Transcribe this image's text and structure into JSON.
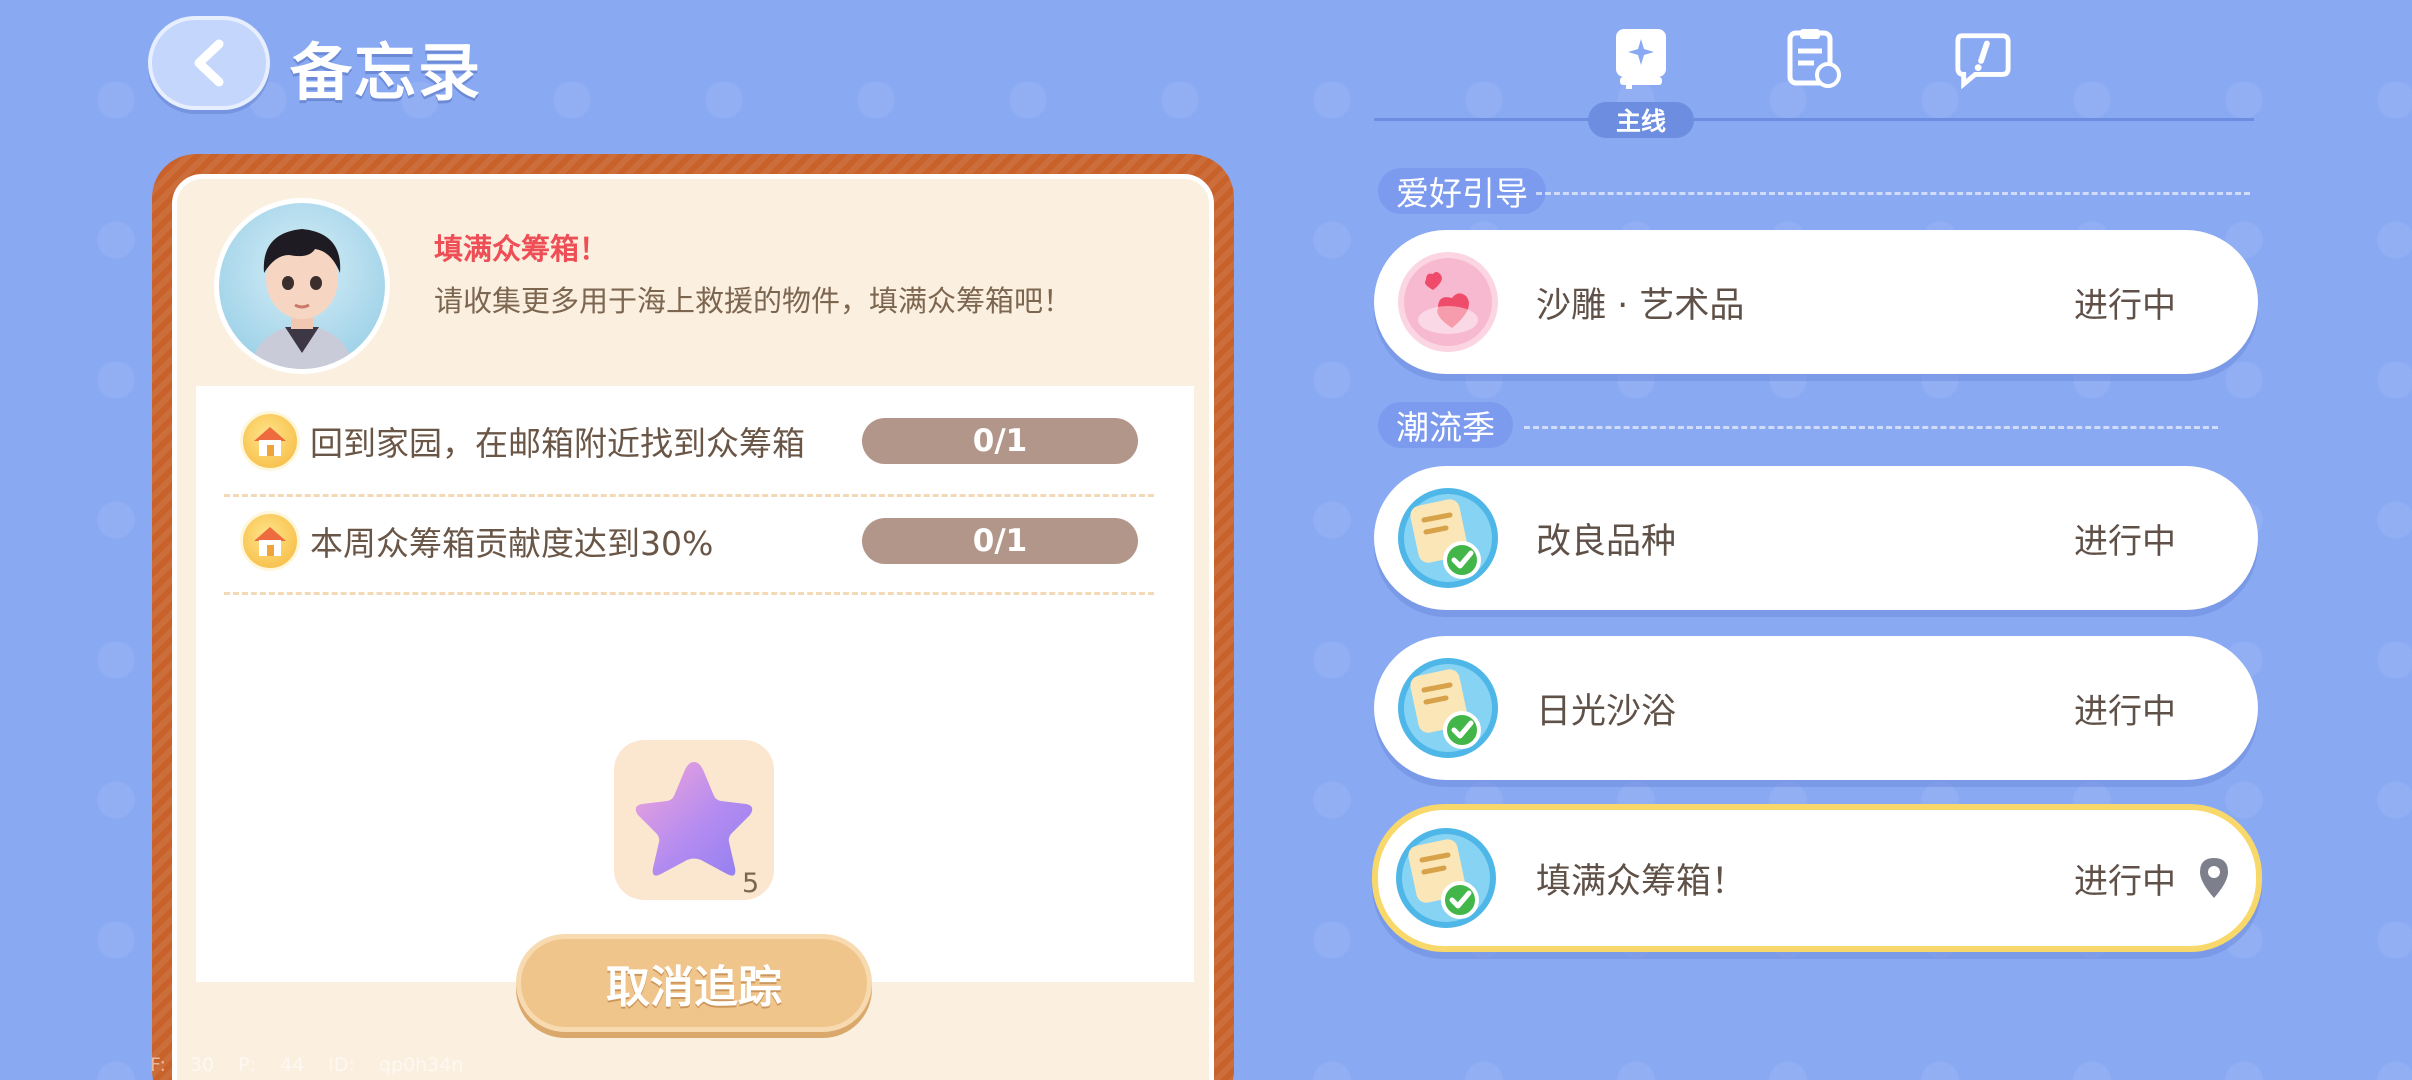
{
  "header": {
    "title": "备忘录"
  },
  "quest": {
    "title": "填满众筹箱！",
    "description": "请收集更多用于海上救援的物件，填满众筹箱吧！",
    "tasks": [
      {
        "text": "回到家园，在邮箱附近找到众筹箱",
        "progress": "0/1"
      },
      {
        "text": "本周众筹箱贡献度达到30%",
        "progress": "0/1"
      }
    ],
    "reward": {
      "icon": "purple-star-icon",
      "count": "5"
    },
    "cancel_label": "取消追踪"
  },
  "tabs": {
    "active_label": "主线",
    "icons": [
      "mainline-book-icon",
      "clipboard-refresh-icon",
      "chat-exclaim-icon"
    ]
  },
  "sections": [
    {
      "label": "爱好引导",
      "items": [
        {
          "name": "沙雕 · 艺术品",
          "status": "进行中",
          "icon": "hearts-icon"
        }
      ]
    },
    {
      "label": "潮流季",
      "items": [
        {
          "name": "改良品种",
          "status": "进行中",
          "icon": "memo-check-icon"
        },
        {
          "name": "日光沙浴",
          "status": "进行中",
          "icon": "memo-check-icon"
        },
        {
          "name": "填满众筹箱！",
          "status": "进行中",
          "icon": "memo-check-icon",
          "tracked": true
        }
      ]
    }
  ],
  "debug": "F: 30 P: 44 ID: qp0h34n",
  "colors": {
    "background": "#8aa9f3",
    "panel_frame": "#c8622a",
    "quest_title": "#ee4e55",
    "progress_pill": "#b3968a",
    "cancel_button": "#f0c58c",
    "active_card_border": "#f8d86a"
  }
}
